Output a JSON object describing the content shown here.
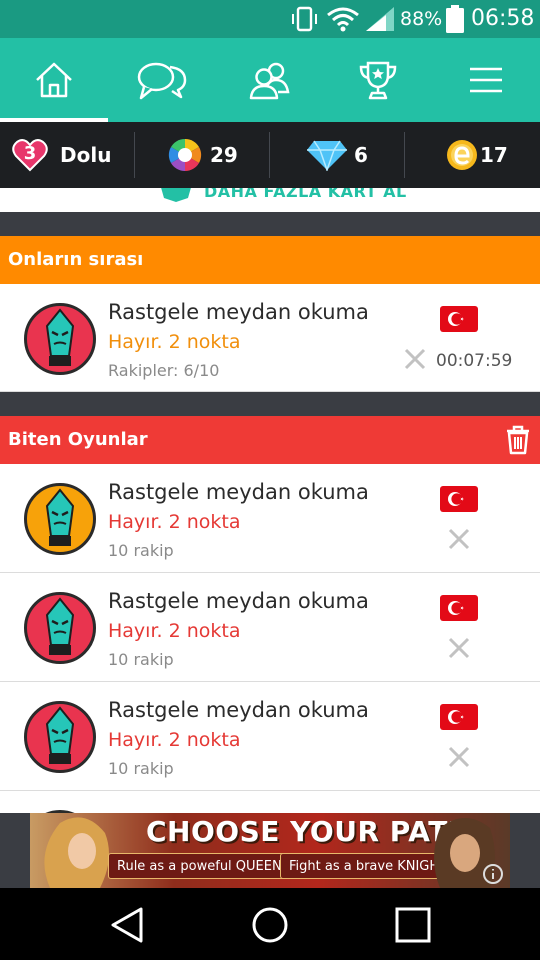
{
  "status_bar": {
    "battery_percent": "88%",
    "time": "06:58"
  },
  "nav_tabs": [
    {
      "icon": "home-icon",
      "active": true
    },
    {
      "icon": "chat-icon",
      "active": false
    },
    {
      "icon": "friends-icon",
      "active": false
    },
    {
      "icon": "trophy-icon",
      "active": false
    },
    {
      "icon": "menu-icon",
      "active": false
    }
  ],
  "resources": {
    "lives": {
      "count": "3",
      "label": "Dolu"
    },
    "colors": {
      "count": "29"
    },
    "diamonds": {
      "count": "6"
    },
    "energy": {
      "count": "17"
    }
  },
  "peek_banner": {
    "text": "DAHA FAZLA KART AL"
  },
  "their_turn": {
    "header": "Onların sırası",
    "games": [
      {
        "title": "Rastgele meydan okuma",
        "points": "Hayır. 2 nokta",
        "opponents": "Rakipler: 6/10",
        "timer": "00:07:59",
        "avatar": "red"
      }
    ]
  },
  "finished": {
    "header": "Biten Oyunlar",
    "games": [
      {
        "title": "Rastgele meydan okuma",
        "points": "Hayır. 2 nokta",
        "opponents": "10 rakip",
        "avatar": "orange"
      },
      {
        "title": "Rastgele meydan okuma",
        "points": "Hayır. 2 nokta",
        "opponents": "10 rakip",
        "avatar": "red"
      },
      {
        "title": "Rastgele meydan okuma",
        "points": "Hayır. 2 nokta",
        "opponents": "10 rakip",
        "avatar": "red"
      }
    ]
  },
  "ad": {
    "headline": "CHOOSE YOUR PATH",
    "left_button": "Rule as a poweful QUEEN",
    "right_button": "Fight as a brave KNIGHT"
  },
  "colors": {
    "teal": "#23c0a5",
    "orange_header": "#ff8a00",
    "red_header": "#ef3a36",
    "orange_text": "#f18f0c",
    "red_text": "#e53935"
  }
}
